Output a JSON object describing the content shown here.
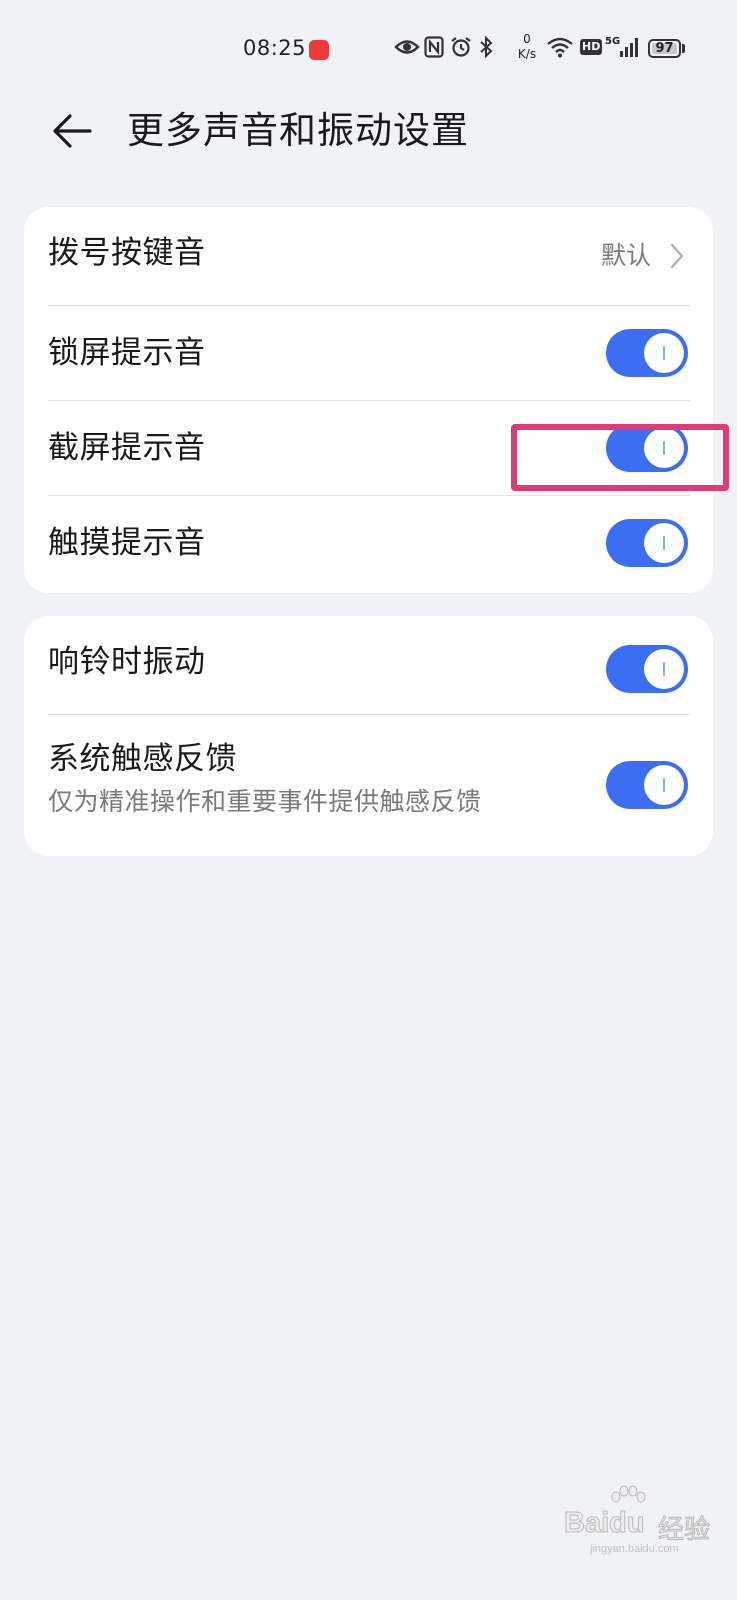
{
  "status_bar": {
    "time": "08:25",
    "net_speed_value": "0",
    "net_speed_unit": "K/s",
    "hd_label": "HD",
    "network_label": "5G",
    "battery_level": "97",
    "icons": [
      "eye-icon",
      "nfc-icon",
      "alarm-icon",
      "bluetooth-icon",
      "wifi-icon",
      "signal-icon",
      "battery-icon"
    ]
  },
  "header": {
    "title": "更多声音和振动设置",
    "back_icon": "arrow-left-icon"
  },
  "sound_settings": {
    "dial_tone": {
      "label": "拨号按键音",
      "value": "默认"
    },
    "lock_sound": {
      "label": "锁屏提示音",
      "enabled": true
    },
    "screenshot_sound": {
      "label": "截屏提示音",
      "enabled": true
    },
    "touch_sound": {
      "label": "触摸提示音",
      "enabled": true
    }
  },
  "vibration_settings": {
    "ring_vibration": {
      "label": "响铃时振动",
      "enabled": true
    },
    "haptic_feedback": {
      "label": "系统触感反馈",
      "description": "仅为精准操作和重要事件提供触感反馈",
      "enabled": true
    }
  },
  "annotation": {
    "highlight_color": "#df3b78"
  },
  "colors": {
    "accent": "#3b6ef2",
    "background": "#f1f2f6",
    "card": "#ffffff"
  },
  "watermark": {
    "logo": "Baidu",
    "text": "经验",
    "url": "jingyan.baidu.com"
  }
}
